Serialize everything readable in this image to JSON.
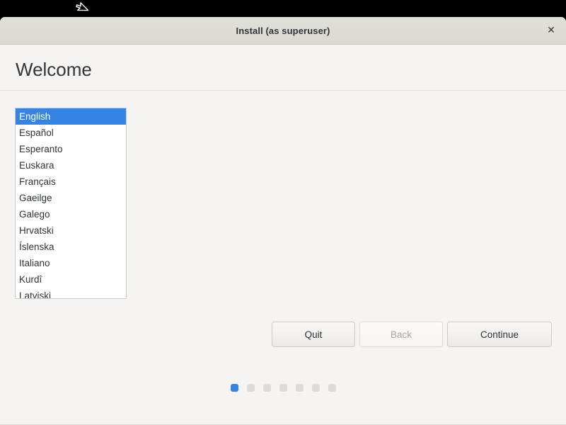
{
  "desktop": {
    "background_color": "#000000",
    "cursor_icon": "arrow-cursor-icon"
  },
  "window": {
    "titlebar": {
      "title": "Install (as superuser)",
      "close_label": "✕",
      "close_icon": "close-icon",
      "background_color": "#dcd9d5"
    },
    "header": {
      "page_title": "Welcome"
    },
    "language_list": {
      "selected": "English",
      "items": [
        "English",
        "Español",
        "Esperanto",
        "Euskara",
        "Français",
        "Gaeilge",
        "Galego",
        "Hrvatski",
        "Íslenska",
        "Italiano",
        "Kurdî",
        "Latviski"
      ],
      "selection_color": "#3584e4",
      "background_color": "#ffffff"
    },
    "nav_buttons": [
      {
        "label": "Quit",
        "name": "quit-button",
        "disabled": false,
        "wide": false
      },
      {
        "label": "Back",
        "name": "back-button",
        "disabled": true,
        "wide": false
      },
      {
        "label": "Continue",
        "name": "continue-button",
        "disabled": false,
        "wide": true
      }
    ],
    "step_dots": {
      "total": 7,
      "active_index": 0,
      "active_color": "#3584e4",
      "inactive_color": "#dedbd7"
    },
    "background_color": "#f5f4f2"
  }
}
